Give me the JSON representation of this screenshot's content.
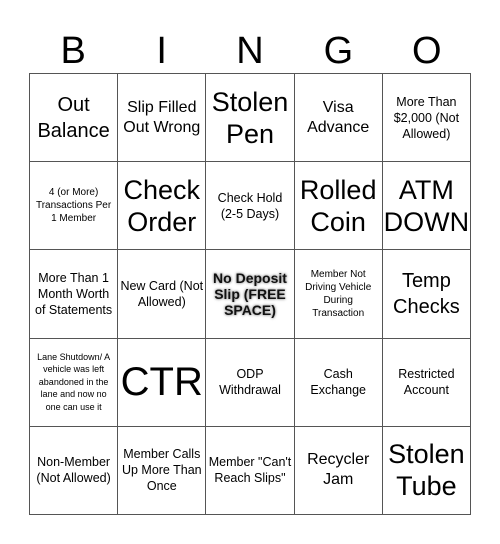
{
  "header": [
    "B",
    "I",
    "N",
    "G",
    "O"
  ],
  "cells": [
    "Out Balance",
    "Slip Filled Out Wrong",
    "Stolen Pen",
    "Visa Advance",
    "More Than $2,000 (Not Allowed)",
    "4 (or More) Transactions Per 1 Member",
    "Check Order",
    "Check Hold (2-5 Days)",
    "Rolled Coin",
    "ATM DOWN",
    "More Than 1 Month Worth of Statements",
    "New Card (Not Allowed)",
    "No Deposit Slip (FREE SPACE)",
    "Member Not Driving Vehicle During Transaction",
    "Temp Checks",
    "Lane Shutdown/ A vehicle was left abandoned in the lane and now no one can use it",
    "CTR",
    "ODP Withdrawal",
    "Cash Exchange",
    "Restricted Account",
    "Non-Member (Not Allowed)",
    "Member Calls Up More Than Once",
    "Member \"Can't Reach Slips\"",
    "Recycler Jam",
    "Stolen Tube"
  ],
  "free_space_index": 12
}
